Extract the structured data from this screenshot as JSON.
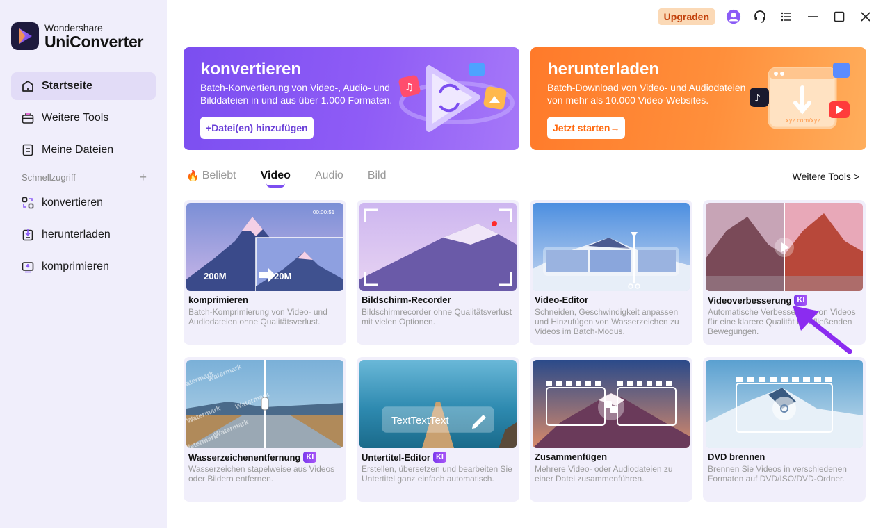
{
  "app": {
    "brand": "Wondershare",
    "product": "UniConverter"
  },
  "sidebar": {
    "items": [
      {
        "label": "Startseite",
        "icon": "home-icon",
        "active": true
      },
      {
        "label": "Weitere Tools",
        "icon": "toolbox-icon",
        "active": false
      },
      {
        "label": "Meine Dateien",
        "icon": "file-icon",
        "active": false
      }
    ],
    "quick_access_label": "Schnellzugriff",
    "quick_access_add": "+",
    "quick_items": [
      {
        "label": "konvertieren",
        "icon": "convert-icon"
      },
      {
        "label": "herunterladen",
        "icon": "download-icon"
      },
      {
        "label": "komprimieren",
        "icon": "compress-icon"
      }
    ]
  },
  "topbar": {
    "upgrade_label": "Upgraden",
    "icons": [
      "avatar-icon",
      "support-icon",
      "menu-icon",
      "minimize-icon",
      "maximize-icon",
      "close-icon"
    ]
  },
  "hero": {
    "convert": {
      "title": "konvertieren",
      "desc": "Batch-Konvertierung von Video-, Audio- und Bilddateien in und aus über 1.000 Formaten.",
      "button": "+Datei(en) hinzufügen"
    },
    "download": {
      "title": "herunterladen",
      "desc": "Batch-Download von Video- und Audiodateien von mehr als 10.000 Video-Websites.",
      "button": "Jetzt starten→",
      "art_url": "xyz.com/xyz"
    }
  },
  "tabs": {
    "items": [
      "Beliebt",
      "Video",
      "Audio",
      "Bild"
    ],
    "active": "Video",
    "more_tools": "Weitere Tools >"
  },
  "cards": [
    {
      "title": "komprimieren",
      "ki": false,
      "desc": "Batch-Komprimierung von Video- und Audiodateien ohne Qualitätsverlust.",
      "overlay_time": "00:00:51",
      "size_from": "200M",
      "size_to": "20M"
    },
    {
      "title": "Bildschirm-Recorder",
      "ki": false,
      "desc": "Bildschirmrecorder ohne Qualitätsverlust mit vielen Optionen."
    },
    {
      "title": "Video-Editor",
      "ki": false,
      "desc": "Schneiden, Geschwindigkeit anpassen und Hinzufügen von Wasserzeichen zu Videos im Batch-Modus."
    },
    {
      "title": "Videoverbesserung",
      "ki": true,
      "desc": "Automatische Verbesserung von Videos für eine klarere Qualität und fließenden Bewegungen."
    },
    {
      "title": "Wasserzeichenentfernung",
      "ki": true,
      "desc": "Wasserzeichen stapelweise aus Videos oder Bildern entfernen.",
      "watermark_text": "Watermark"
    },
    {
      "title": "Untertitel-Editor",
      "ki": true,
      "desc": "Erstellen, übersetzen und bearbeiten Sie Untertitel ganz einfach automatisch.",
      "overlay_text": "TextTextText"
    },
    {
      "title": "Zusammenfügen",
      "ki": false,
      "desc": "Mehrere Video- oder Audiodateien zu einer Datei zusammenführen."
    },
    {
      "title": "DVD brennen",
      "ki": false,
      "desc": "Brennen Sie Videos in verschiedenen Formaten auf DVD/ISO/DVD-Ordner."
    }
  ],
  "ki_label": "KI",
  "colors": {
    "accent": "#7c4ef0",
    "convert_banner": "#8f5cf6",
    "download_banner": "#ff8f3b",
    "upgrade_bg": "#fbd9b6"
  }
}
